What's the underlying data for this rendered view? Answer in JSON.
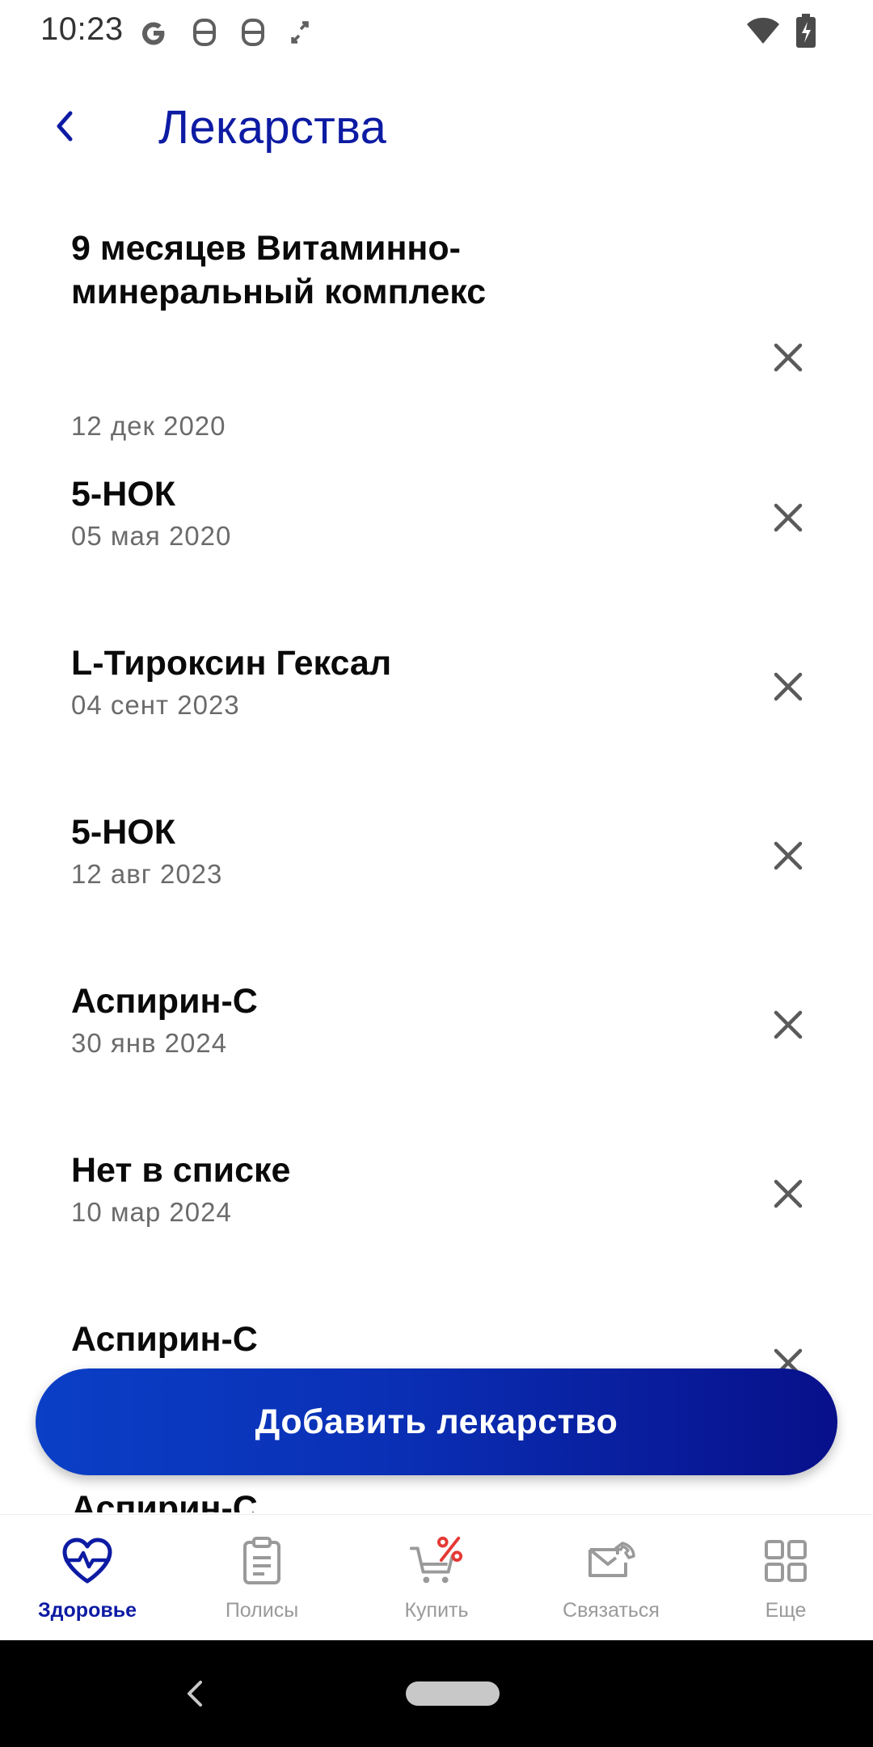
{
  "status_bar": {
    "time": "10:23",
    "left_icons": [
      "google-icon",
      "notification-icon",
      "notification-icon",
      "fullscreen-icon"
    ],
    "right_icons": [
      "wifi-icon",
      "battery-charging-icon"
    ]
  },
  "header": {
    "title": "Лекарства",
    "back_icon": "chevron-left-icon"
  },
  "medications": [
    {
      "name": "9 месяцев Витаминно-минеральный комплекс",
      "date": "12 дек 2020"
    },
    {
      "name": "5-НОК",
      "date": "05 мая 2020"
    },
    {
      "name": "L-Тироксин Гексал",
      "date": "04 сент 2023"
    },
    {
      "name": "5-НОК",
      "date": "12 авг 2023"
    },
    {
      "name": "Аспирин-С",
      "date": "30 янв 2024"
    },
    {
      "name": "Нет в списке",
      "date": "10 мар 2024"
    },
    {
      "name": "Аспирин-С",
      "date": ""
    },
    {
      "name": "Аспирин-С",
      "date": ""
    }
  ],
  "add_button": {
    "label": "Добавить лекарство"
  },
  "bottom_nav": {
    "items": [
      {
        "label": "Здоровье",
        "icon": "heart-pulse-icon",
        "active": true
      },
      {
        "label": "Полисы",
        "icon": "clipboard-icon",
        "active": false
      },
      {
        "label": "Купить",
        "icon": "cart-percent-icon",
        "active": false
      },
      {
        "label": "Связаться",
        "icon": "envelope-phone-icon",
        "active": false
      },
      {
        "label": "Еще",
        "icon": "grid-icon",
        "active": false
      }
    ]
  },
  "colors": {
    "accent": "#0d1ba3",
    "inactive": "#9a9a9a",
    "promo": "#e53935",
    "button_gradient_start": "#0a3fc6",
    "button_gradient_end": "#08108a"
  }
}
